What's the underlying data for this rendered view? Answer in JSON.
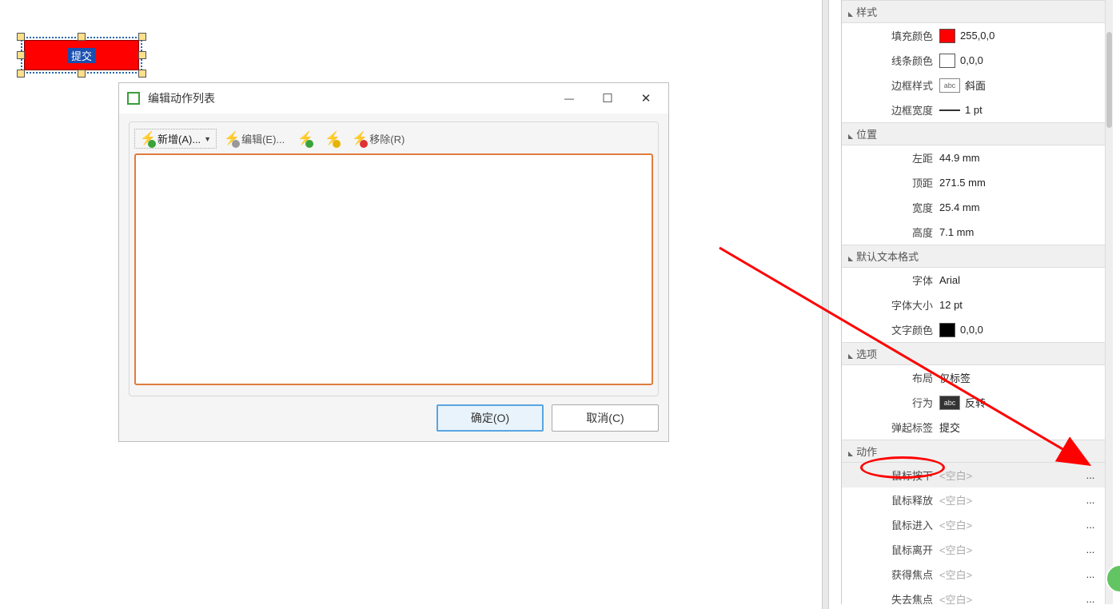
{
  "canvas": {
    "button_label": "提交"
  },
  "dialog": {
    "title": "编辑动作列表",
    "toolbar": {
      "add": "新增(A)...",
      "edit": "编辑(E)...",
      "remove": "移除(R)"
    },
    "ok": "确定(O)",
    "cancel": "取消(C)"
  },
  "panel": {
    "sections": {
      "style": "样式",
      "position": "位置",
      "textfmt": "默认文本格式",
      "options": "选项",
      "actions": "动作"
    },
    "style": {
      "fill_label": "填充颜色",
      "fill_value": "255,0,0",
      "fill_swatch": "#ff0000",
      "line_label": "线条颜色",
      "line_value": "0,0,0",
      "line_swatch": "#ffffff",
      "border_style_label": "边框样式",
      "border_style_value": "斜面",
      "border_width_label": "边框宽度",
      "border_width_value": "1 pt"
    },
    "position": {
      "left_label": "左距",
      "left_value": "44.9 mm",
      "top_label": "顶距",
      "top_value": "271.5 mm",
      "width_label": "宽度",
      "width_value": "25.4 mm",
      "height_label": "高度",
      "height_value": "7.1 mm"
    },
    "textfmt": {
      "font_label": "字体",
      "font_value": "Arial",
      "size_label": "字体大小",
      "size_value": "12 pt",
      "color_label": "文字颜色",
      "color_value": "0,0,0",
      "color_swatch": "#000000"
    },
    "options": {
      "layout_label": "布局",
      "layout_value": "仅标签",
      "behavior_label": "行为",
      "behavior_value": "反转",
      "uplabel_label": "弹起标签",
      "uplabel_value": "提交"
    },
    "actions": {
      "mousedown_label": "鼠标按下",
      "mouseup_label": "鼠标释放",
      "mousein_label": "鼠标进入",
      "mouseout_label": "鼠标离开",
      "focus_label": "获得焦点",
      "blur_label": "失去焦点",
      "empty": "<空白>",
      "dots": "..."
    }
  }
}
